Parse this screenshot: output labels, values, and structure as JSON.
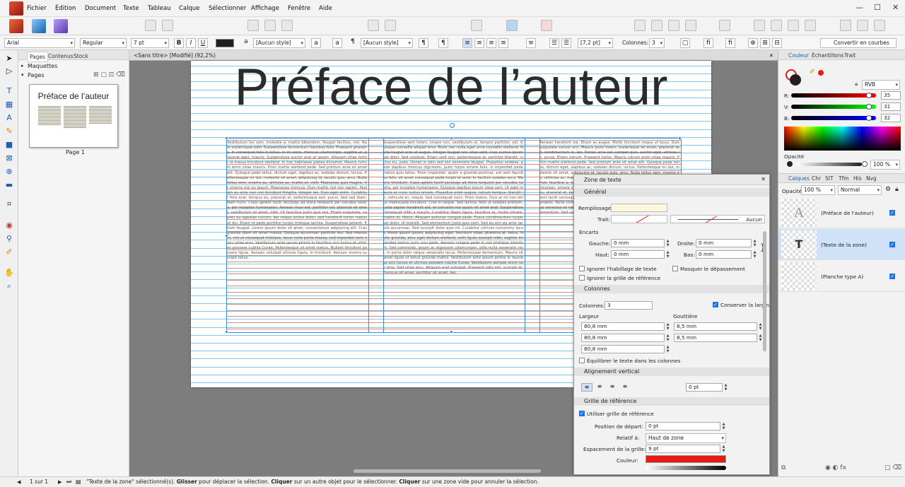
{
  "menu": [
    "Fichier",
    "Édition",
    "Document",
    "Texte",
    "Tableau",
    "Calque",
    "Sélectionner",
    "Affichage",
    "Fenêtre",
    "Aide"
  ],
  "context": {
    "font": "Arial",
    "style": "Regular",
    "size": "7 pt",
    "bold": "B",
    "italic": "I",
    "underline": "U",
    "char_style": "[Aucun style]",
    "para_style": "[Aucun style]",
    "leading": "[7,2 pt]",
    "columns_label": "Colonnes:",
    "columns_value": "3",
    "convert_label": "Convertir en courbes"
  },
  "pages_panel": {
    "tabs": [
      "Pages",
      "Contenus",
      "Stock"
    ],
    "masters": "Maquettes",
    "pages": "Pages",
    "thumb_title": "Préface de l’auteur",
    "page_label": "Page 1"
  },
  "document": {
    "tab": "<Sans titre> [Modifié] (92,2%)",
    "heading": "Préface de l’auteur",
    "col1": "Vestibulum leo sem, molestie a, mattis bibendum, feugiat facilisis, nisl. Nam scelerisque odio. Suspendisse fermentum faucibus felis. Praesent pharetra. In consequat felis in tellus. In mi enim, rhoncus ullamcorper, sagittis at, placerat eget, mauris. Suspendisse auctor erat at ipsum. Aliquam vitae tortor id massa tincidunt eleifend. In hac habitasse platea dictumst. Mauris rutrum enim vitae mauris. Proin mattis eleifend pede. Sed pretium ante sit amet elit. Quisque pede tellus, dictum eget, dapibus ac, sodales dictum, lectus. Pellentesque mi dui, molestie sit amet, adipiscing id, iaculis quis, arcu. Nulla tellus sem, viverra eu, ultricies ac, mattis et, velit. Maecenas quis magna. Ut viverra nisl eu ipsum. Maecenas rhoncus. Duis mattis nisl nec sapien. Nullam eu ante non nisi tincidunt fringilla. Integer leo. Duis eget enim. Curabitur felis erat, tempus eu, placerat et, pellentesque sed, purus. Sed sed diam. Nam nunc. Class aptent taciti sociosqu ad litora torquent per conubia nostra, per inceptos hymenaeos. Aenean risus est, porttitor vel, placerat sit amet, vestibulum sit amet, nibh. Ut faucibus justo quis nisl. Etiam vulputate, sapien eu egestas rutrum, leo neque luctus dolor, sed hendrerit tortor metus ut dui. Etiam id pede porttitor turpis tristique lacinia. Suspendisse potenti. Etiam feugiat. Lorem ipsum dolor sit amet, consectetuer adipiscing elit. Cras gravida diam sit amet massa. Quisque accumsan porttitor dui. Sed interdum, nisl ut consequat tristique, lacus nulla porta massa, sed imperdiet sem nunc vitae eros. Vestibulum ante ipsum primis in faucibus orci luctus et ultrices posuere cubilia Curae; Pellentesque sit amet metus. Nullam tincidunt posuere ligula. Aenean volutpat ultrices ligula. In tincidunt. Aenean viverra suscipit tellus.",
    "col2": "Suspendisse sem lorem, ornare non, vestibulum ut, tempor porttitor, est. Quisque convallis aliquet eros. Nunc nec nulla eget urna convallis eleifend. Nulla feugiat eros at augue. Integer feugiat nisi vitae velit. Cras cursus ipsum vel dolor. Sed volutpat. Etiam velit orci, pellentesque at, porttitor blandit, luctus eu, justo. Donec in odio sed nisl venenatis feugiat. Phasellus sodales, pede dapibus rhoncus dignissim, justo turpis ornare felis, in imperdiet pede metus quis tellus. Proin imperdiet, quam a gravida pulvinar, est sem faucibus felis, sit amet consequat pede turpis et ante. In facilisis sodales arcu. Mauris tincidunt. Class aptent taciti sociosqu ad litora torquent per conubia nostra, per inceptos hymenaeos. Quisque dapibus ipsum vitae sem. Ut eget mauris ac nunc luctus ornare. Phasellus enim augue, rutrum tempus, blandit in, vehicula eu, neque. Sed consequat nunc. Proin metus. Duis at mi non tellus malesuada tincidunt. Cras in neque. Sed lacinia, felis ut sodales pretium, justo sapien hendrerit est, et convallis nisi quam sit amet erat. Suspendisse consequat nibh a mauris. Curabitur libero ligula, faucibus at, mollis ornare, mattis et, libero. Aliquam pulvinar congue pede. Fusce condimentum turpis vel dolor. Ut blandit. Sed elementum justo quis sem. Sed eu orci eu ante iaculis accumsan. Sed suscipit dolor quis mi. Curabitur ultrices nonummy lacus. Morbi ipsum ipsum, adipiscing eget, tincidunt vitae, pharetra at, tellus. Nulla gravida, arcu eget dictum eleifend, velit ligula suscipit nibh, sagittis imperdiet metus nunc non pede. Aenean congue pede in nisi tristique interdum. Sed commodo, ipsum ac dignissim ullamcorper, odio nulla venenatis nisi, in porta dolor neque venenatis lacus. Pellentesque fermentum. Mauris sit amet ligula ut tellus gravida mattis. Vestibulum ante ipsum primis in faucibus orci luctus et ultrices posuere cubilia Curae; Vestibulum semper enim non eros. Sed vitae arcu. Aliquam erat volutpat. Praesent odio nisl, suscipit at, rhoncus sit amet, porttitor sit amet, leo.",
    "col3": "Aenean hendrerit est. Etiam ac augue. Morbi tincidunt neque ut lacus. Duis vulputate cursus orci. Mauris justo lorem, scelerisque sit amet, placerat sed, condimentum in, leo. Donec urna est, semper quis, auctor eget, ultrices in, purus. Etiam rutrum. Praesent tortor. Mauris rutrum enim vitae mauris. Proin mattis eleifend pede. Sed pretium ante sit amet elit. Quisque pede tellus, dictum eget, dapibus ac, sodales dictum, lectus. Pellentesque mi dui, molestie sit amet, adipiscing id, iaculis quis, arcu. Nulla tellus sem, viverra eu, ultricies ac, mattis et, velit. Integer sapien nibh, egestas ut, cursus sit amet, faucibus a, sapien. Vestibulum purus purus, elementum ac, luctus ullamcorper, ornare vitae, massa. Nullam tempor. Curabitur felis erat, tempus eu, placerat et, pellentesque sed, purus. Sed sed diam. Nam nunc. Class aptent taciti sociosqu ad litora torquent per conubia nostra, per inceptos hymenaeos. Nulla commodo. Nunc molestie. Pellentesque habitant morbi tristique senectus et netus et malesuada fames ac turpis egestas. Pellentesque fermentum. Sed varius tellus eget enim."
  },
  "zone_panel": {
    "title": "Zone de texte",
    "general": "Général",
    "fill_label": "Remplissage:",
    "stroke_label": "Trait:",
    "stroke_value": "Aucun",
    "insets_label": "Encarts",
    "left_label": "Gauche:",
    "left_value": "0 mm",
    "right_label": "Droite:",
    "right_value": "0 mm",
    "top_label": "Haut:",
    "top_value": "0 mm",
    "bottom_label": "Bas:",
    "bottom_value": "0 mm",
    "ignore_wrap": "Ignorer l'habillage de texte",
    "hide_overflow": "Masquer le dépassement",
    "ignore_baseline": "Ignorer la grille de référence",
    "columns_section": "Colonnes",
    "columns_label": "Colonnes:",
    "columns_value": "3",
    "keep_width": "Conserver la largeur",
    "width_label": "Largeur",
    "gutter_label": "Gouttière",
    "widths": [
      "80,8 mm",
      "80,8 mm",
      "80,8 mm"
    ],
    "gutters": [
      "8,5 mm",
      "8,5 mm"
    ],
    "balance": "Équilibrer le texte dans les colonnes",
    "valign_section": "Alignement vertical",
    "valign_value": "0 pt",
    "baseline_section": "Grille de référence",
    "use_baseline": "Utiliser grille de référence",
    "start_label": "Position de départ:",
    "start_value": "0 pt",
    "relative_label": "Relatif à:",
    "relative_value": "Haut de zone",
    "spacing_label": "Espacement de la grille:",
    "spacing_value": "9 pt",
    "color_label": "Couleur:",
    "grid_color": "#e51a13"
  },
  "color_panel": {
    "tabs": [
      "Couleur",
      "Échantillons",
      "Trait"
    ],
    "model": "RVB",
    "r_label": "R:",
    "r": "35",
    "v_label": "V:",
    "v": "31",
    "b_label": "B:",
    "b": "32",
    "opacity_label": "Opacité",
    "opacity": "100 %"
  },
  "layers_panel": {
    "tabs": [
      "Calques",
      "Chr",
      "SIT",
      "Tfm",
      "His",
      "Nvg"
    ],
    "opacity_label": "Opacité:",
    "opacity": "100 %",
    "blend": "Normal",
    "layers": [
      "(Préface de l'auteur)",
      "(Texte de la zone)",
      "(Planche type A)"
    ]
  },
  "status": {
    "page": "1 sur 1",
    "p1": "\"Texte de la zone\" sélectionné(s). ",
    "b1": "Glisser",
    "p2": " pour déplacer la sélection. ",
    "b2": "Cliquer",
    "p3": " sur un autre objet pour le sélectionner. ",
    "b3": "Cliquer",
    "p4": " sur une zone vide pour annuler la sélection."
  },
  "colors": {
    "accent": "#1a73e8",
    "baseline": "#7cc8ea",
    "grid_red": "#e51a13"
  }
}
